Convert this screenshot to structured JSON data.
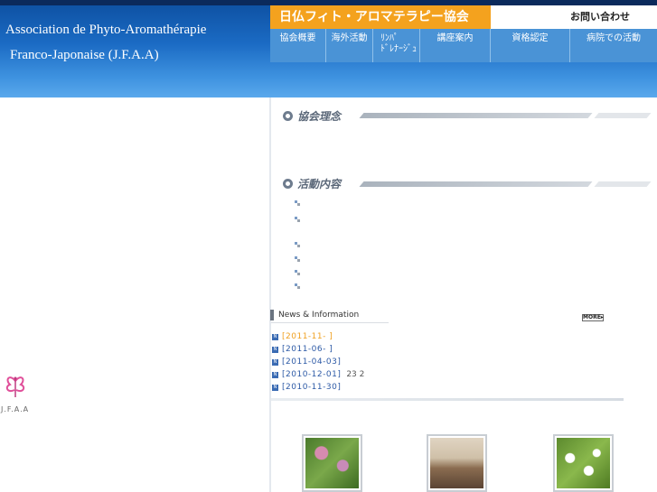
{
  "header": {
    "assoc_line1": "Association de Phyto-Aromathérapie",
    "assoc_line2": "Franco-Japonaise (J.F.A.A)",
    "title": "日仏フィト・アロマテラピー協会",
    "contact": "お問い合わせ",
    "menu": [
      {
        "label": "協会概要"
      },
      {
        "label": "海外活動"
      },
      {
        "label": "ﾘﾝﾊﾟ\nﾄﾞﾚﾅｰｼﾞｭ"
      },
      {
        "label": "講座案内"
      },
      {
        "label": "資格認定"
      },
      {
        "label": "病院での活動"
      }
    ]
  },
  "sections": {
    "philosophy_title": "協会理念",
    "activities_title": "活動内容"
  },
  "news": {
    "title": "News & Information",
    "more": "MORE▸",
    "items": [
      {
        "date": "[2011-11- ]",
        "extra": ""
      },
      {
        "date": "[2011-06- ]",
        "extra": ""
      },
      {
        "date": "[2011-04-03]",
        "extra": ""
      },
      {
        "date": "[2010-12-01]",
        "extra": "23 2"
      },
      {
        "date": "[2010-11-30]",
        "extra": ""
      }
    ]
  },
  "logo": {
    "text": "J.F.A.A"
  },
  "colors": {
    "header_blue": "#1b6bc4",
    "title_orange": "#f4a21e",
    "nav_blue": "#4a93d6",
    "link_blue": "#2d5aa6",
    "highlight_orange": "#f0a020"
  }
}
